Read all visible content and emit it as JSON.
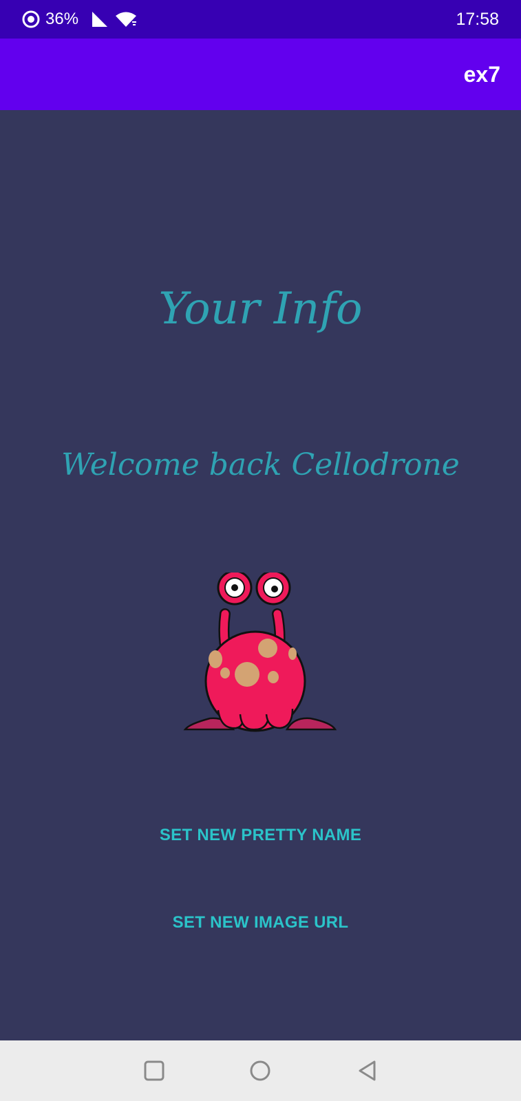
{
  "status_bar": {
    "battery_percent": "36%",
    "time": "17:58",
    "icons": [
      "battery-ring-icon",
      "signal-icon",
      "wifi-icon"
    ]
  },
  "app_bar": {
    "title": "ex7"
  },
  "main": {
    "title": "Your Info",
    "welcome": "Welcome back Cellodrone",
    "avatar_icon": "pink-alien-monster-icon",
    "buttons": {
      "set_name": "SET NEW PRETTY NAME",
      "set_image": "SET NEW IMAGE URL"
    }
  },
  "nav_bar": {
    "icons": [
      "recents-square-icon",
      "home-circle-icon",
      "back-triangle-icon"
    ]
  },
  "colors": {
    "status_bar": "#3700b3",
    "app_bar": "#6200ee",
    "background": "#35375c",
    "headline_text": "#2fa3b3",
    "button_text": "#2bc3c9",
    "nav_bar": "#ececec",
    "alien_body": "#ef1a5a",
    "alien_spots": "#d3a373"
  }
}
